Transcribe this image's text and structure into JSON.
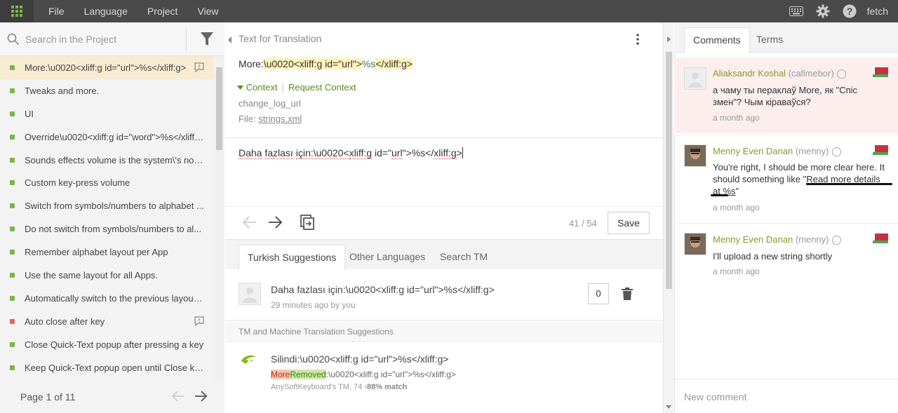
{
  "topbar": {
    "menu": [
      "File",
      "Language",
      "Project",
      "View"
    ],
    "user": "fetch"
  },
  "left": {
    "search_placeholder": "Search in the Project",
    "strings": [
      {
        "text": "More:\\u0020<xliff:g id=\"url\">%s</xliff:g>",
        "status": "green",
        "comment": true,
        "active": true
      },
      {
        "text": "Tweaks and more.",
        "status": "green"
      },
      {
        "text": "UI",
        "status": "green"
      },
      {
        "text": "Override\\u0020<xliff:g id=\"word\">%s</xliff:...",
        "status": "green"
      },
      {
        "text": "Sounds effects volume is the system\\'s noti...",
        "status": "green"
      },
      {
        "text": "Custom key-press volume",
        "status": "green"
      },
      {
        "text": "Switch from symbols/numbers to alphabet ...",
        "status": "green"
      },
      {
        "text": "Do not switch from symbols/numbers to al...",
        "status": "green"
      },
      {
        "text": "Remember alphabet layout per App",
        "status": "green"
      },
      {
        "text": "Use the same layout for all Apps.",
        "status": "green"
      },
      {
        "text": "Automatically switch to the previous layout ...",
        "status": "green"
      },
      {
        "text": "Auto close after key",
        "status": "red",
        "comment": true
      },
      {
        "text": "Close Quick-Text popup after pressing a key",
        "status": "green"
      },
      {
        "text": "Keep Quick-Text popup open until Close ke...",
        "status": "green"
      }
    ],
    "page_label": "Page 1 of 11"
  },
  "editor": {
    "header": "Text for Translation",
    "source_prefix": "More:",
    "source_escape": "\\u0020",
    "source_tag_open": "<xliff:g id=\"url\">",
    "source_ph": "%s",
    "source_tag_close": "</xliff:g>",
    "context_label": "Context",
    "request_context": "Request Context",
    "key": "change_log_url",
    "file_label": "File:",
    "file_name": "strings.xml",
    "translation_words": [
      "Daha",
      "fazlası",
      "için:\\u0020<",
      "xliff:g",
      "id=\"",
      "url",
      "\">%s</",
      "xliff:g",
      ">"
    ],
    "counter": "41 / 54",
    "save_label": "Save"
  },
  "suggestions": {
    "tabs": [
      "Turkish Suggestions",
      "Other Languages",
      "Search TM"
    ],
    "active_tab": 0,
    "items": [
      {
        "text": "Daha fazlası için:\\u0020<xliff:g id=\"url\">%s</xliff:g>",
        "meta": "29 minutes ago by you",
        "votes": "0"
      }
    ],
    "tm_header": "TM and Machine Translation Suggestions",
    "tm": {
      "text": "Silindi:\\u0020<xliff:g id=\"url\">%s</xliff:g>",
      "diff_del": "More",
      "diff_ins": "Removed",
      "diff_rest": ":\\u0020<xliff:g id=\"url\">%s</xliff:g>",
      "source": "AnySoftKeyboard's TM, 74",
      "match": "88% match"
    }
  },
  "right": {
    "tabs": [
      "Comments",
      "Terms"
    ],
    "comments": [
      {
        "name": "Aliaksandr Koshal",
        "handle": "(callmebor)",
        "body": "а чаму ты пераклаў More, як \"Спіс змен\"? Чым кіраваўся?",
        "when": "a month ago",
        "highlight": true
      },
      {
        "name": "Menny Even Danan",
        "handle": "(menny)",
        "body_pre": "You're right, I should be more clear here. It should something like \"",
        "body_link": "Read more details at %s",
        "body_post": "\"",
        "when": "a month ago"
      },
      {
        "name": "Menny Even Danan",
        "handle": "(menny)",
        "body": "I'll upload a new string shortly",
        "when": "a month ago"
      }
    ],
    "new_comment_placeholder": "New comment"
  }
}
